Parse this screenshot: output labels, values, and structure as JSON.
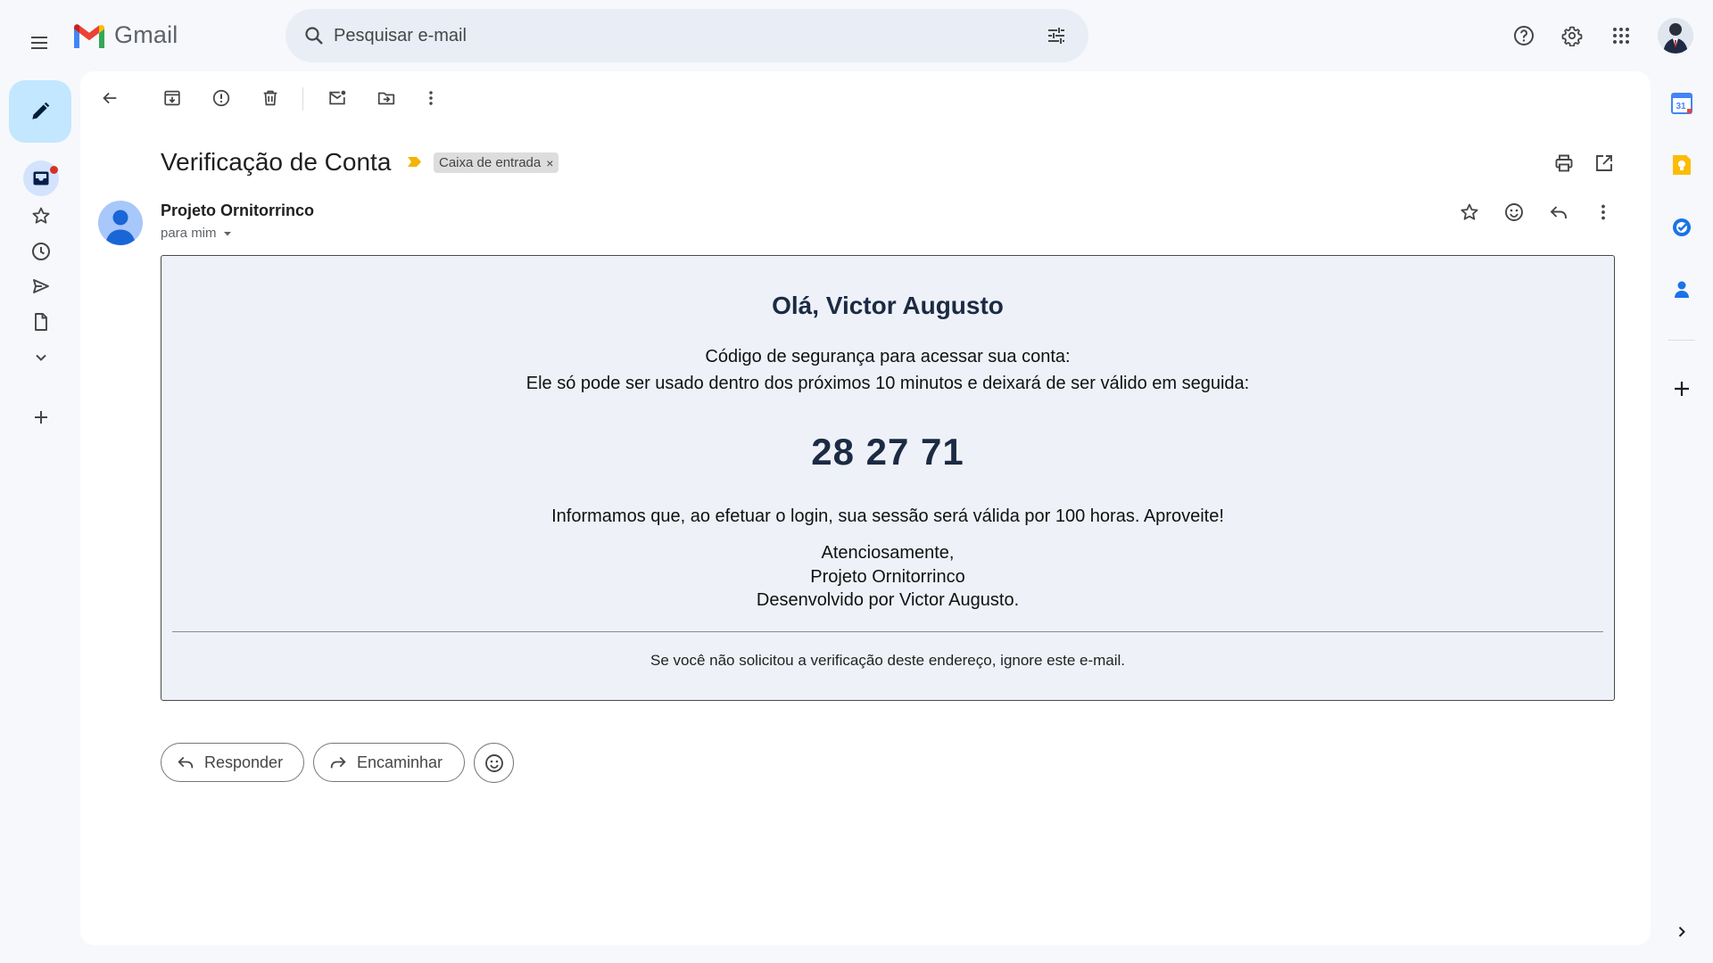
{
  "app": {
    "name": "Gmail",
    "icons": {
      "menu": "menu-icon",
      "logo": "gmail-m-logo",
      "search": "search-icon",
      "filter": "tune-icon",
      "help": "help-icon",
      "settings": "gear-icon",
      "apps": "apps-grid-icon",
      "account": "account-avatar"
    }
  },
  "search": {
    "placeholder": "Pesquisar e-mail",
    "value": ""
  },
  "nav": {
    "items": [
      {
        "icon": "pencil-icon",
        "role": "compose"
      },
      {
        "icon": "inbox-icon",
        "role": "inbox",
        "selected": true,
        "has_unread_dot": true
      },
      {
        "icon": "star-icon",
        "role": "starred"
      },
      {
        "icon": "clock-icon",
        "role": "snoozed"
      },
      {
        "icon": "send-icon",
        "role": "sent"
      },
      {
        "icon": "draft-icon",
        "role": "drafts"
      },
      {
        "icon": "chevron-down-icon",
        "role": "more"
      },
      {
        "icon": "plus-icon",
        "role": "new-label"
      }
    ]
  },
  "toolbar": {
    "icons": [
      "back-arrow-icon",
      "archive-icon",
      "report-spam-icon",
      "trash-icon",
      "mark-unread-icon",
      "move-to-icon",
      "more-vert-icon"
    ]
  },
  "email": {
    "subject": "Verificação de Conta",
    "label": "Caixa de entrada",
    "label_remove": "×",
    "sender": "Projeto Ornitorrinco",
    "recipient": "para mim",
    "body": {
      "greeting": "Olá, Victor Augusto",
      "line1": "Código de segurança para acessar sua conta:",
      "line2": "Ele só pode ser usado dentro dos próximos 10 minutos e deixará de ser válido em seguida:",
      "code": "28 27 71",
      "session": "Informamos que, ao efetuar o login, sua sessão será válida por 100 horas. Aproveite!",
      "sign_off": "Atenciosamente,",
      "sign_name": "Projeto Ornitorrinco",
      "sign_dev": "Desenvolvido por Victor Augusto.",
      "footnote": "Se você não solicitou a verificação deste endereço, ignore este e-mail."
    }
  },
  "actions": {
    "reply": "Responder",
    "forward": "Encaminhar"
  },
  "side_panel": {
    "icons": [
      "calendar-icon",
      "keep-icon",
      "tasks-icon",
      "contacts-icon",
      "add-addon-icon",
      "expand-panel-icon"
    ],
    "calendar_day": "31"
  },
  "colors": {
    "background": "#f6f8fc",
    "compose": "#c2e7ff",
    "search": "#e9eef6",
    "selected_nav": "#d3e3fd",
    "mail_box": "#eef2f8",
    "code_text": "#1c2a44",
    "important_marker": "#f4b400"
  }
}
